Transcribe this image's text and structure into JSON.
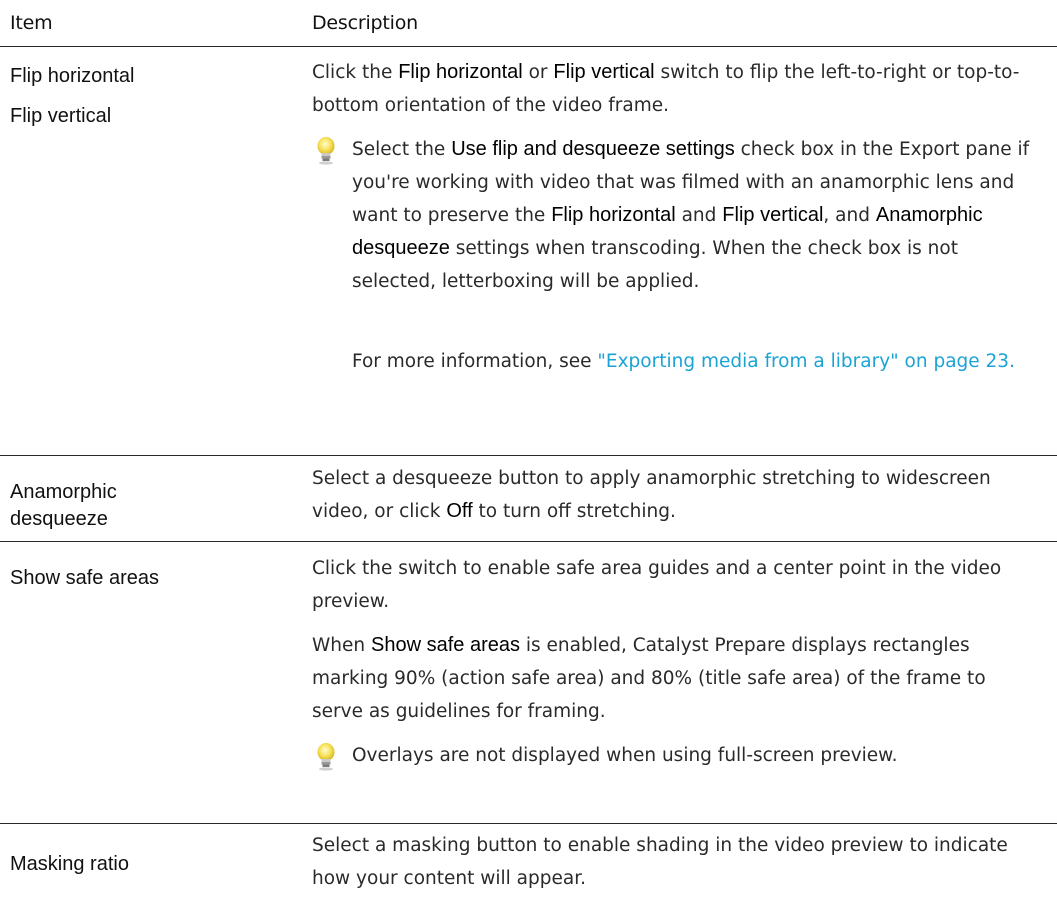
{
  "header": {
    "item": "Item",
    "description": "Description"
  },
  "rows": {
    "flip": {
      "labels": [
        "Flip horizontal",
        "Flip vertical"
      ],
      "desc": {
        "t1": "Click the ",
        "b1": "Flip horizontal",
        "t2": " or ",
        "b2": "Flip vertical",
        "t3": " switch to flip the left-to-right or top-to-bottom orientation of the video frame."
      },
      "tip": {
        "icon": "lightbulb-icon",
        "t1": "Select the ",
        "b1": "Use flip and desqueeze settings",
        "t2": " check box in the Export pane if you're working with video that was filmed with an anamorphic lens and want to preserve the ",
        "b2": "Flip horizontal",
        "t3": " and ",
        "b3": "Flip vertical",
        "t4": ", and ",
        "b4": "Anamorphic desqueeze",
        "t5": " settings when transcoding. When the check box is not selected, letterboxing will be applied."
      },
      "more": {
        "t1": "For more information, see ",
        "link": "\"Exporting media from a library\" on page 23."
      }
    },
    "anamorphic": {
      "label_line1": "Anamorphic",
      "label_line2": "desqueeze",
      "desc": {
        "t1": "Select a desqueeze button to apply anamorphic stretching to widescreen video, or click ",
        "b1": "Off",
        "t2": " to turn off stretching."
      }
    },
    "safe_areas": {
      "label": "Show safe areas",
      "desc1": "Click the switch to enable safe area guides and a center point in the video preview.",
      "desc2": {
        "t1": "When ",
        "b1": "Show safe areas",
        "t2": " is enabled, Catalyst Prepare displays rectangles marking 90% (action safe area) and 80% (title safe area) of the frame to serve as guidelines for framing."
      },
      "tip": {
        "icon": "lightbulb-icon",
        "text": "Overlays are not displayed when using full-screen preview."
      }
    },
    "masking": {
      "label": "Masking ratio",
      "desc": "Select a masking button to enable shading in the video preview to indicate how your content will appear."
    }
  },
  "colors": {
    "link": "#1ba3d6",
    "rule": "#2a2a2a"
  }
}
